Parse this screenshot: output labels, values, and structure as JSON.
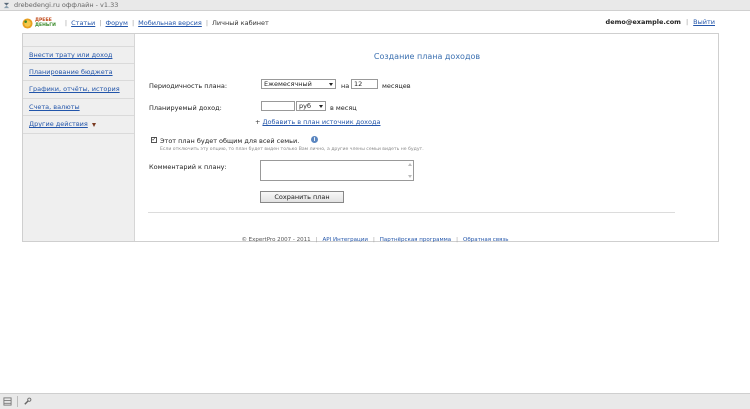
{
  "window": {
    "title": "drebedengi.ru оффлайн - v1.33"
  },
  "header": {
    "logo": {
      "line1": "ДРЕБЕ",
      "line2": "ДЕНЬГИ"
    },
    "nav": [
      {
        "label": "Статьи",
        "link": true
      },
      {
        "label": "Форум",
        "link": true
      },
      {
        "label": "Мобильная версия",
        "link": true
      },
      {
        "label": "Личный кабинет",
        "link": false
      }
    ],
    "user_email": "demo@example.com",
    "logout_label": "Выйти"
  },
  "sidebar": {
    "items": [
      {
        "label": "Внести трату или доход"
      },
      {
        "label": "Планирование бюджета"
      },
      {
        "label": "Графики, отчёты, история"
      },
      {
        "label": "Счета, валюты"
      },
      {
        "label": "Другие действия"
      }
    ]
  },
  "form": {
    "title": "Создание плана доходов",
    "period_label": "Периодичность плана:",
    "period_value": "Ежемесячный",
    "on_label": "на",
    "months_value": "12",
    "months_label": "месяцев",
    "income_label": "Планируемый доход:",
    "income_value": "",
    "currency_value": "руб",
    "per_month_label": "в месяц",
    "add_source_label": "Добавить в план источник дохода",
    "shared_checked": true,
    "shared_label": "Этот план будет общим для всей семьи.",
    "shared_hint": "Если отключить эту опцию, то план будет виден только Вам лично, а другие члены семьи видеть не будут.",
    "comment_label": "Комментарий к плану:",
    "comment_value": "",
    "save_label": "Сохранить план"
  },
  "footer": {
    "copyright": "© ExpertPro 2007 - 2011",
    "links": [
      "API Интеграции",
      "Партнёрская программа",
      "Обратная связь"
    ]
  },
  "colors": {
    "link": "#2255aa",
    "heading": "#3a6fb0",
    "sidebar_bg": "#efefef"
  }
}
